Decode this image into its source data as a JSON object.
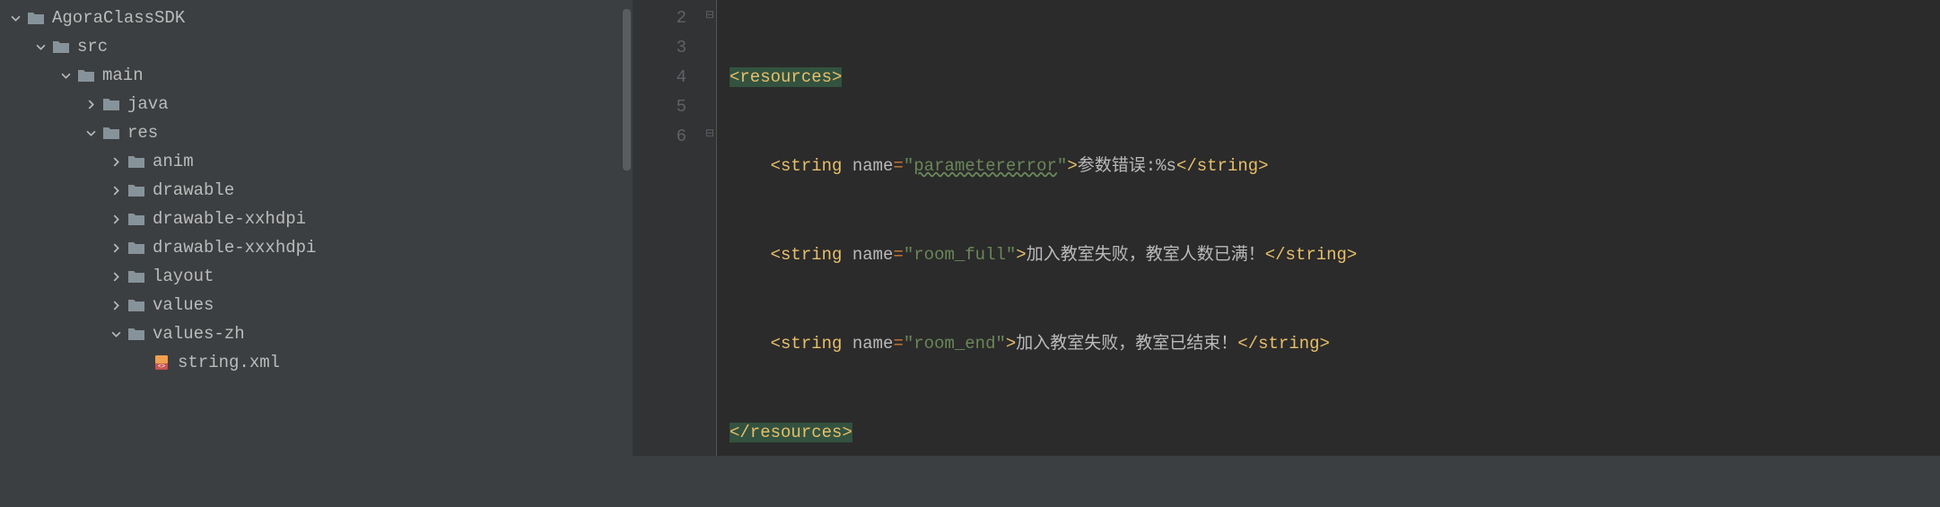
{
  "tree": {
    "items": [
      {
        "depth": 0,
        "expand": "down",
        "icon": "folder",
        "label": "AgoraClassSDK"
      },
      {
        "depth": 1,
        "expand": "down",
        "icon": "folder",
        "label": "src"
      },
      {
        "depth": 2,
        "expand": "down",
        "icon": "folder",
        "label": "main"
      },
      {
        "depth": 3,
        "expand": "right",
        "icon": "folder",
        "label": "java"
      },
      {
        "depth": 3,
        "expand": "down",
        "icon": "folder",
        "label": "res"
      },
      {
        "depth": 4,
        "expand": "right",
        "icon": "folder",
        "label": "anim"
      },
      {
        "depth": 4,
        "expand": "right",
        "icon": "folder",
        "label": "drawable"
      },
      {
        "depth": 4,
        "expand": "right",
        "icon": "folder",
        "label": "drawable-xxhdpi"
      },
      {
        "depth": 4,
        "expand": "right",
        "icon": "folder",
        "label": "drawable-xxxhdpi"
      },
      {
        "depth": 4,
        "expand": "right",
        "icon": "folder",
        "label": "layout"
      },
      {
        "depth": 4,
        "expand": "right",
        "icon": "folder",
        "label": "values"
      },
      {
        "depth": 4,
        "expand": "down",
        "icon": "folder",
        "label": "values-zh"
      },
      {
        "depth": 5,
        "expand": "none",
        "icon": "xml-file",
        "label": "string.xml"
      }
    ]
  },
  "editor": {
    "line_numbers": [
      "2",
      "3",
      "4",
      "5",
      "6"
    ],
    "lines": {
      "l2": {
        "open_tag": "<resources>"
      },
      "l3": {
        "pre": "    ",
        "open": "<string",
        "attr": " name",
        "eq": "=",
        "val_q1": "\"",
        "val": "parametererror",
        "val_q2": "\"",
        "close_o": ">",
        "text": "参数错误:%s",
        "close": "</string>"
      },
      "l4": {
        "pre": "    ",
        "open": "<string",
        "attr": " name",
        "eq": "=",
        "val_q1": "\"",
        "val": "room_full",
        "val_q2": "\"",
        "close_o": ">",
        "text": "加入教室失败，教室人数已满！",
        "close": "</string>"
      },
      "l5": {
        "pre": "    ",
        "open": "<string",
        "attr": " name",
        "eq": "=",
        "val_q1": "\"",
        "val": "room_end",
        "val_q2": "\"",
        "close_o": ">",
        "text": "加入教室失败，教室已结束！",
        "close": "</string>"
      },
      "l6": {
        "close_tag": "</resources>"
      }
    }
  }
}
